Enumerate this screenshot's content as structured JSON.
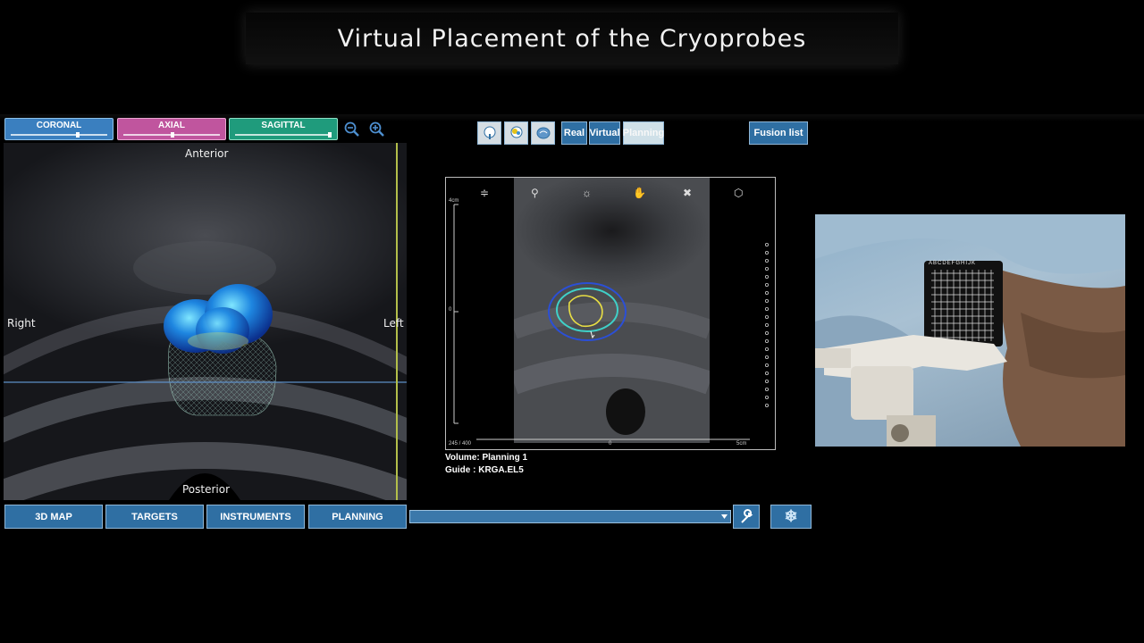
{
  "title": "Virtual Placement of the Cryoprobes",
  "view_tabs": [
    {
      "label": "CORONAL",
      "color": "#3a7fbf",
      "slider": 0.66
    },
    {
      "label": "AXIAL",
      "color": "#c0559e",
      "slider": 0.5
    },
    {
      "label": "SAGITTAL",
      "color": "#1f9b7c",
      "slider": 0.97
    }
  ],
  "zoom": {
    "out_icon": "zoom-out-icon",
    "in_icon": "zoom-in-icon"
  },
  "left_view": {
    "anterior": "Anterior",
    "posterior": "Posterior",
    "right": "Right",
    "left": "Left"
  },
  "mode_buttons": {
    "real": "Real",
    "virtual": "Virtual",
    "planning": "Planning",
    "icons": [
      "prostate-icon",
      "prostate-target-icon",
      "brain-icon"
    ]
  },
  "fusion_list": "Fusion list",
  "planning_view": {
    "tools": [
      "align-icon",
      "zoom-icon",
      "brightness-icon",
      "hand-pan-icon",
      "close-x-icon",
      "cube-icon"
    ],
    "scale_top": "4cm",
    "scale_mid": "0",
    "frame_counter": "245 / 400",
    "scale_bottom_left": "0",
    "scale_bottom_right": "5cm"
  },
  "info": {
    "volume": "Volume: Planning 1",
    "guide": "Guide : KRGA.EL5"
  },
  "bottom_buttons": [
    "3D MAP",
    "TARGETS",
    "INSTRUMENTS",
    "PLANNING"
  ],
  "tools": {
    "wrench_icon": "wrench-icon",
    "snowflake_icon": "snowflake-icon"
  },
  "grid_letters": "ABCDEFGHIJK"
}
